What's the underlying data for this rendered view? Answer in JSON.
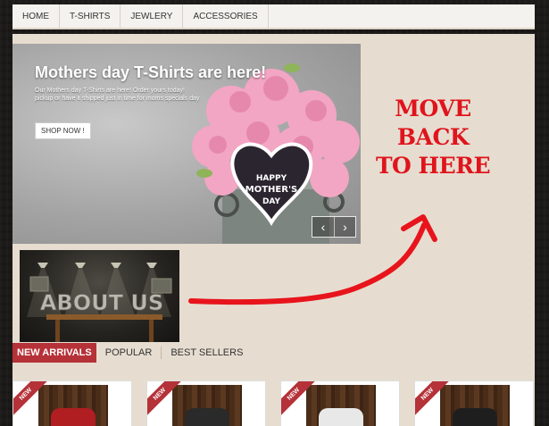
{
  "nav": {
    "items": [
      "HOME",
      "T-SHIRTS",
      "JEWLERY",
      "ACCESSORIES"
    ]
  },
  "slider": {
    "title": "Mothers day T-Shirts are here!",
    "text": "Our Mothers day T-Shirts are here! Order yours today! pickup or have it shipped just in time for moms specials day",
    "button": "SHOP NOW !",
    "heart_text": [
      "HAPPY",
      "MOTHER'S",
      "DAY"
    ],
    "prev": "‹",
    "next": "›"
  },
  "about": {
    "label": "ABOUT US"
  },
  "annotation": {
    "line1": "MOVE BACK",
    "line2": "TO HERE",
    "color": "#e0141c"
  },
  "tabs": [
    "NEW ARRIVALS",
    "POPULAR",
    "BEST SELLERS"
  ],
  "products": [
    {
      "badge": "NEW",
      "shirt_color": "#b01e22"
    },
    {
      "badge": "NEW",
      "shirt_color": "#2a2a2a"
    },
    {
      "badge": "NEW",
      "shirt_color": "#e8e8e8"
    },
    {
      "badge": "NEW",
      "shirt_color": "#1e1e1e"
    }
  ],
  "colors": {
    "accent": "#b53238",
    "page_bg": "#e6ddd0"
  }
}
